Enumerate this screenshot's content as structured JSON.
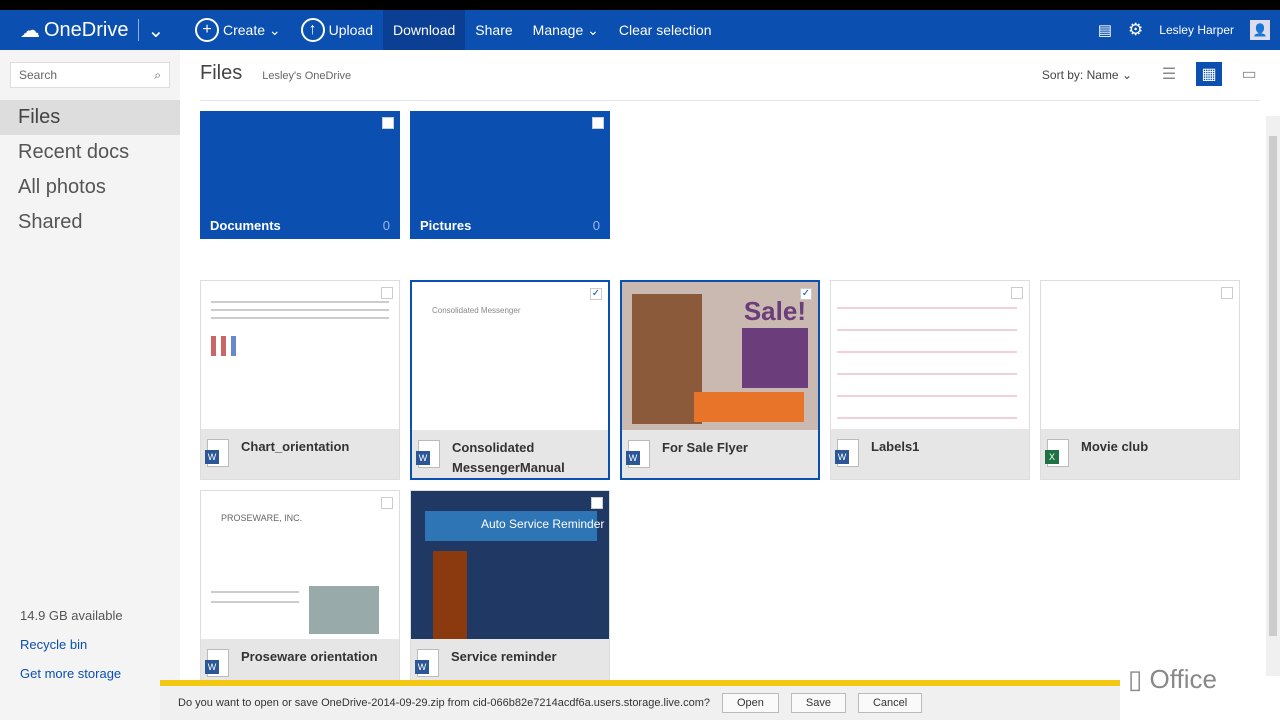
{
  "topbar": {
    "brand": "OneDrive",
    "create": "Create",
    "upload": "Upload",
    "download": "Download",
    "share": "Share",
    "manage": "Manage",
    "clear": "Clear selection",
    "user": "Lesley Harper"
  },
  "sidebar": {
    "search_placeholder": "Search",
    "items": [
      {
        "label": "Files"
      },
      {
        "label": "Recent docs"
      },
      {
        "label": "All photos"
      },
      {
        "label": "Shared"
      }
    ],
    "storage": "14.9 GB available",
    "recycle": "Recycle bin",
    "more_storage": "Get more storage"
  },
  "main": {
    "title": "Files",
    "breadcrumb": "Lesley's OneDrive",
    "sort": "Sort by: Name",
    "folders": [
      {
        "name": "Documents",
        "count": "0"
      },
      {
        "name": "Pictures",
        "count": "0"
      }
    ],
    "files": [
      {
        "name": "Chart_orientation",
        "type": "word",
        "selected": false
      },
      {
        "name": "Consolidated MessengerManual",
        "type": "word",
        "selected": true
      },
      {
        "name": "For Sale Flyer",
        "type": "word",
        "selected": true
      },
      {
        "name": "Labels1",
        "type": "word",
        "selected": false
      },
      {
        "name": "Movie club",
        "type": "excel",
        "selected": false
      },
      {
        "name": "Proseware orientation",
        "type": "word",
        "selected": false
      },
      {
        "name": "Service reminder",
        "type": "word",
        "selected": false
      }
    ],
    "thumb_text": {
      "consolidated": "Consolidated Messenger",
      "sale": "Sale!",
      "proseware": "PROSEWARE, INC.",
      "service": "Auto Service Reminder"
    }
  },
  "download_bar": {
    "message": "Do you want to open or save OneDrive-2014-09-29.zip from cid-066b82e7214acdf6a.users.storage.live.com?",
    "open": "Open",
    "save": "Save",
    "cancel": "Cancel"
  },
  "watermark": "Office"
}
